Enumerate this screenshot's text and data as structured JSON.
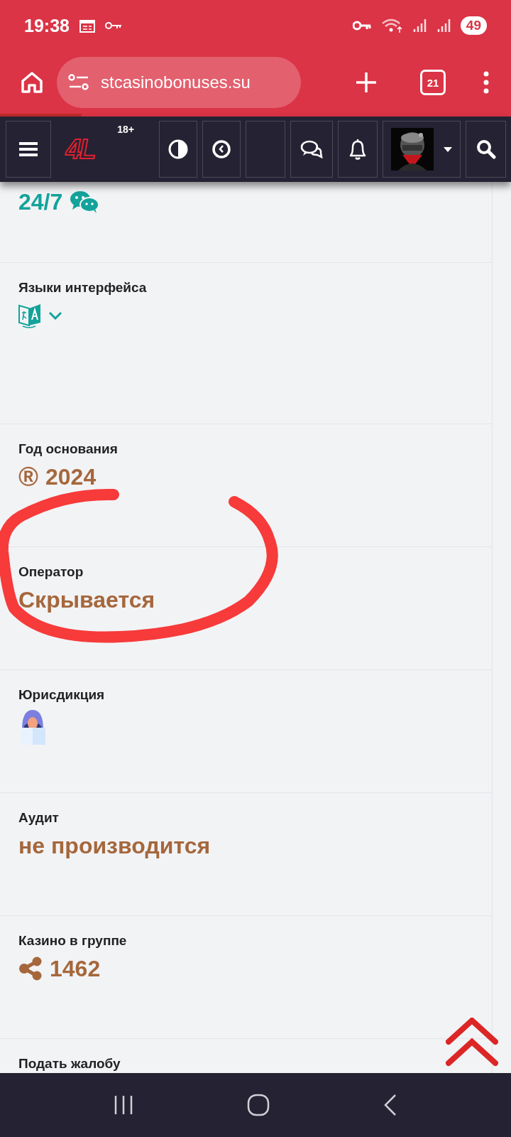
{
  "status_bar": {
    "time": "19:38",
    "battery": "49"
  },
  "browser": {
    "url": "stcasinobonuses.su",
    "tabs_count": "21",
    "load_progress": {
      "level": 0.16
    }
  },
  "site_header": {
    "logo": "4L",
    "age_badge": "18+"
  },
  "sections": [
    {
      "kind": "support",
      "value": "24/7"
    },
    {
      "kind": "languages",
      "label": "Языки интерфейса"
    },
    {
      "kind": "year",
      "label": "Год основания",
      "symbol": "®",
      "value": "2024"
    },
    {
      "kind": "text",
      "label": "Оператор",
      "value": "Скрывается"
    },
    {
      "kind": "jurisdiction",
      "label": "Юрисдикция"
    },
    {
      "kind": "text",
      "label": "Аудит",
      "value": "не производится"
    },
    {
      "kind": "count",
      "label": "Казино в группе",
      "value": "1462"
    },
    {
      "kind": "label_only",
      "label": "Подать жалобу"
    }
  ]
}
